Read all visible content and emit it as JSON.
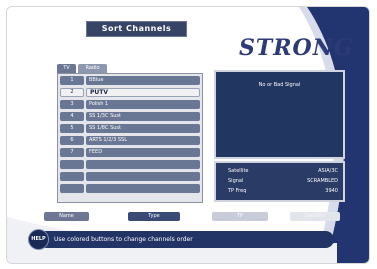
{
  "title": "Sort Channels",
  "logo": "STRONG",
  "tabs": [
    {
      "label": "TV"
    },
    {
      "label": "Radio"
    }
  ],
  "channels": [
    {
      "num": "1",
      "name": "BBlue"
    },
    {
      "num": "2",
      "name": "PUTV"
    },
    {
      "num": "3",
      "name": "Polish 1"
    },
    {
      "num": "4",
      "name": "SS 1/3C Sust"
    },
    {
      "num": "5",
      "name": "SS 1/8C Sust"
    },
    {
      "num": "6",
      "name": "ARTS 1/2/3 SSL"
    },
    {
      "num": "7",
      "name": "FEED"
    }
  ],
  "selected_index": 1,
  "preview": {
    "message": "No or Bad Signal"
  },
  "info": {
    "satellite_label": "Satellite",
    "satellite_value": "ASIA/3C",
    "signal_label": "Signal",
    "signal_value": "SCRAMBLED",
    "tp_label": "TP Freq",
    "tp_value": "3940"
  },
  "buttons": {
    "red": "Name",
    "green": "Type",
    "yellow": "TP",
    "blue": "Satellite"
  },
  "help": {
    "icon_label": "HELP",
    "text": "Use colored buttons to change channels order"
  },
  "colors": {
    "accent": "#223466",
    "logo": "#2c3a78",
    "selected_row": "#f1f1f4"
  }
}
